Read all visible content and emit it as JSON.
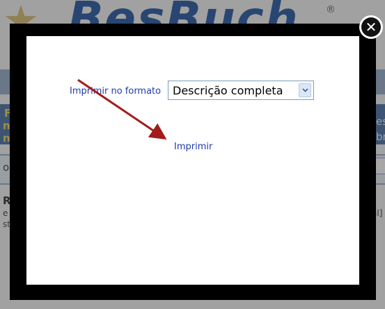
{
  "background": {
    "logo_text": "BesBuch",
    "logo_reg": "®",
    "fragments": [
      "F",
      "nc",
      "nc",
      "oo",
      "RA",
      "e n",
      "st,",
      "es",
      "br",
      "al]"
    ]
  },
  "modal": {
    "close_glyph": "✕",
    "format_label": "Imprimir no formato",
    "format_select": {
      "selected": "Descrição completa",
      "options": [
        "Descrição completa"
      ]
    },
    "print_link": "Imprimir"
  },
  "colors": {
    "link": "#1f3ba8",
    "annotation_arrow": "#a31b1b",
    "overlay_border": "#000000"
  },
  "icons": {
    "close": "close-icon",
    "dropdown": "chevron-down-icon",
    "annotation": "arrow-annotation-icon"
  }
}
